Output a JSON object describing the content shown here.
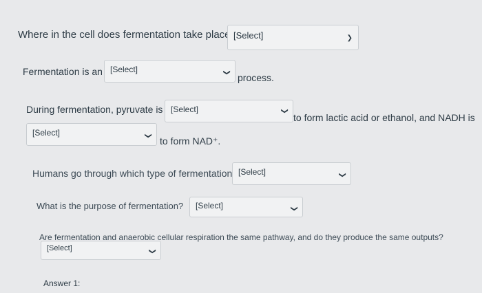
{
  "q1": {
    "text": "Where in the cell does fermentation take place?",
    "select": "[Select]"
  },
  "q2": {
    "prefix": "Fermentation is an",
    "select": "[Select]",
    "suffix": "process."
  },
  "q3": {
    "prefix": "During fermentation, pyruvate is",
    "select1": "[Select]",
    "middle": "to form lactic acid or ethanol, and NADH is",
    "select2": "[Select]",
    "suffix": "to form NAD⁺."
  },
  "q4": {
    "text": "Humans go through which type of fermentation?",
    "select": "[Select]"
  },
  "q5": {
    "text": "What is the purpose of fermentation?",
    "select": "[Select]"
  },
  "q6": {
    "text": "Are fermentation and anaerobic cellular respiration the same pathway, and do they produce the same outputs?",
    "select": "[Select]"
  },
  "answer": {
    "label": "Answer 1:"
  },
  "icons": {
    "dropdown": "chevron-down-icon"
  }
}
